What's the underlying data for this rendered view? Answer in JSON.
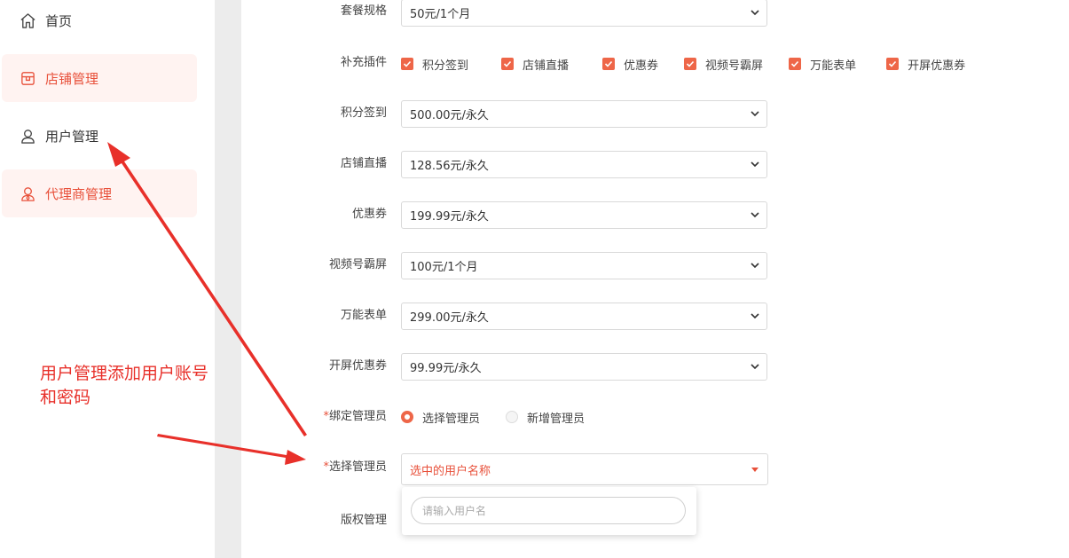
{
  "sidebar": {
    "items": [
      {
        "label": "首页",
        "icon": "home-icon"
      },
      {
        "label": "店铺管理",
        "icon": "store-icon"
      },
      {
        "label": "用户管理",
        "icon": "user-icon"
      },
      {
        "label": "代理商管理",
        "icon": "agent-icon"
      }
    ]
  },
  "form": {
    "package": {
      "label": "套餐规格",
      "value": "50元/1个月"
    },
    "addons": {
      "label": "补充插件",
      "options": [
        "积分签到",
        "店铺直播",
        "优惠券",
        "视频号霸屏",
        "万能表单",
        "开屏优惠券"
      ]
    },
    "prices": [
      {
        "label": "积分签到",
        "value": "500.00元/永久"
      },
      {
        "label": "店铺直播",
        "value": "128.56元/永久"
      },
      {
        "label": "优惠券",
        "value": "199.99元/永久"
      },
      {
        "label": "视频号霸屏",
        "value": "100元/1个月"
      },
      {
        "label": "万能表单",
        "value": "299.00元/永久"
      },
      {
        "label": "开屏优惠券",
        "value": "99.99元/永久"
      }
    ],
    "bind_admin": {
      "star": "*",
      "label": "绑定管理员",
      "options": [
        "选择管理员",
        "新增管理员"
      ],
      "selected": "选择管理员"
    },
    "select_admin": {
      "star": "*",
      "label": "选择管理员",
      "placeholder": "选中的用户名称"
    },
    "dropdown_search": {
      "placeholder": "请输入用户名"
    },
    "copyright": {
      "label": "版权管理"
    }
  },
  "annotation": {
    "text": "用户管理添加用户账号和密码"
  },
  "colors": {
    "accent": "#ee6648",
    "annotation": "#e8302a",
    "active_bg": "#fff3f1"
  }
}
